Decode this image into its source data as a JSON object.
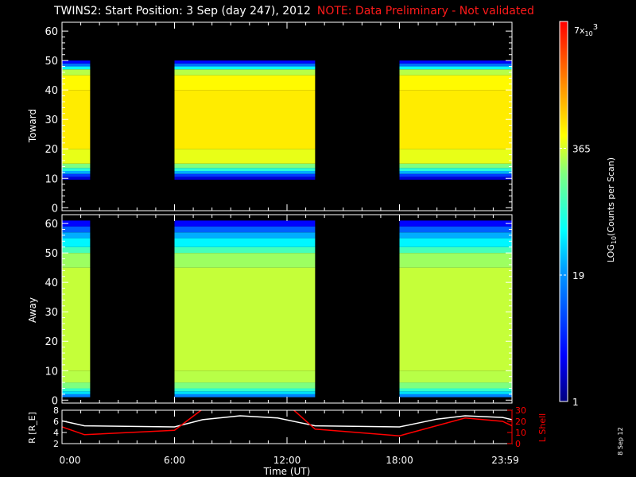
{
  "title": "TWINS2: Start Position:  3 Sep (day 247), 2012",
  "note": "NOTE: Data Preliminary - Not validated",
  "date_stamp": "8 Sep 12",
  "colors": {
    "axis": "#ffffff",
    "note": "#ff1a1a",
    "lshell": "#ff0000",
    "radius": "#ffffff"
  },
  "chart_data": [
    {
      "type": "heatmap",
      "panel": "toward",
      "ylabel": "Toward",
      "ylim": [
        -1,
        63
      ],
      "yticks": [
        0,
        10,
        20,
        30,
        40,
        50,
        60
      ],
      "xlim_hours": [
        0,
        24
      ],
      "coverage_hours": [
        [
          0,
          1.5
        ],
        [
          6.0,
          13.5
        ],
        [
          18.0,
          24
        ]
      ],
      "profile": [
        [
          9.5,
          10.5,
          2
        ],
        [
          10.5,
          11.5,
          6
        ],
        [
          11.5,
          12.5,
          25
        ],
        [
          12.5,
          13.5,
          80
        ],
        [
          13.5,
          15,
          200
        ],
        [
          15,
          20,
          420
        ],
        [
          20,
          40,
          600
        ],
        [
          40,
          45,
          520
        ],
        [
          45,
          47,
          300
        ],
        [
          47,
          48,
          60
        ],
        [
          48,
          49,
          12
        ],
        [
          49,
          50,
          3
        ]
      ]
    },
    {
      "type": "heatmap",
      "panel": "away",
      "ylabel": "Away",
      "ylim": [
        -1,
        63
      ],
      "yticks": [
        0,
        10,
        20,
        30,
        40,
        50,
        60
      ],
      "xlim_hours": [
        0,
        24
      ],
      "coverage_hours": [
        [
          0,
          1.5
        ],
        [
          6.0,
          13.5
        ],
        [
          18.0,
          24
        ]
      ],
      "profile": [
        [
          1,
          2,
          15
        ],
        [
          2,
          3,
          40
        ],
        [
          3,
          4,
          90
        ],
        [
          4,
          6,
          200
        ],
        [
          6,
          10,
          300
        ],
        [
          10,
          45,
          330
        ],
        [
          45,
          50,
          250
        ],
        [
          50,
          52,
          110
        ],
        [
          52,
          55,
          50
        ],
        [
          55,
          57,
          25
        ],
        [
          57,
          59,
          10
        ],
        [
          59,
          61,
          3
        ]
      ]
    },
    {
      "type": "line",
      "panel": "orbit",
      "xlabel": "Time (UT)",
      "xticks": [
        "0:00",
        "6:00",
        "12:00",
        "18:00",
        "23:59"
      ],
      "ylabel": "R [R_E]",
      "ylim": [
        2,
        8
      ],
      "yticks": [
        "2",
        "4",
        "6",
        "8"
      ],
      "y2label": "L Shell",
      "y2lim": [
        0,
        30
      ],
      "y2ticks": [
        "0",
        "10",
        "20",
        "30"
      ],
      "series": [
        {
          "name": "R",
          "axis": "left",
          "x": [
            0,
            1.2,
            6.0,
            7.5,
            9.5,
            11.5,
            13.5,
            18.0,
            20,
            21.5,
            23.5,
            24
          ],
          "y": [
            6.1,
            5.2,
            5.0,
            6.3,
            7.0,
            6.6,
            5.2,
            5.0,
            6.4,
            7.0,
            6.7,
            6.3
          ]
        },
        {
          "name": "L Shell",
          "axis": "right",
          "x": [
            0,
            1.2,
            6.0,
            7.5,
            12.3,
            13.5,
            18.0,
            21.5,
            23.5,
            24
          ],
          "y": [
            15,
            8,
            12,
            31,
            31,
            13,
            7,
            23,
            20,
            16
          ]
        }
      ]
    }
  ],
  "colorbar": {
    "label_main": "LOG",
    "label_sub": "10",
    "label_rest": "(Counts per Scan)",
    "range": [
      1,
      7000
    ],
    "ticks": [
      "1",
      "19",
      "365"
    ],
    "top_label_base": "7x",
    "top_label_sub": "10",
    "top_label_exp": "3"
  }
}
